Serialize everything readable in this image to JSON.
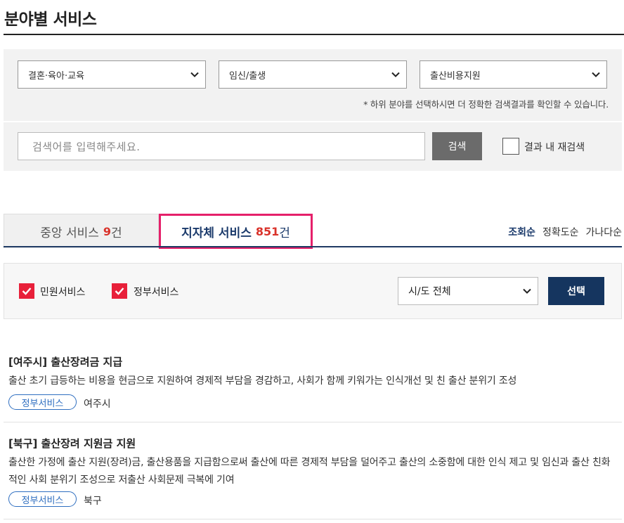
{
  "page": {
    "title": "분야별 서비스"
  },
  "filters": {
    "category1": "결혼·육아·교육",
    "category2": "임신/출생",
    "category3": "출산비용지원",
    "hint": "* 하위 분야를 선택하시면 더 정확한 검색결과를 확인할 수 있습니다."
  },
  "search": {
    "placeholder": "검색어를 입력해주세요.",
    "button_label": "검색",
    "re_search_label": "결과 내 재검색"
  },
  "tabs": [
    {
      "label": "중앙 서비스",
      "count": "9",
      "unit": "건",
      "active": false
    },
    {
      "label": "지자체 서비스",
      "count": "851",
      "unit": "건",
      "active": true
    }
  ],
  "sort": {
    "options": [
      "조회순",
      "정확도순",
      "가나다순"
    ],
    "active": "조회순"
  },
  "options": {
    "civil_label": "민원서비스",
    "gov_label": "정부서비스",
    "region_select": "시/도 전체",
    "apply_label": "선택"
  },
  "results": [
    {
      "title": "[여주시] 출산장려금 지급",
      "desc": "출산 초기 급등하는 비용을 현금으로 지원하여 경제적 부담을 경감하고, 사회가 함께 키워가는 인식개선 및 친 출산 분위기 조성",
      "badge": "정부서비스",
      "region": "여주시"
    },
    {
      "title": "[북구] 출산장려 지원금 지원",
      "desc": "출산한 가정에 출산 지원(장려)금, 출산용품을 지급함으로써 출산에 따른 경제적 부담을 덜어주고 출산의 소중함에 대한 인식 제고 및 임신과 출산 친화적인 사회 분위기 조성으로 저출산 사회문제 극복에 기여",
      "badge": "정부서비스",
      "region": "북구"
    }
  ],
  "colors": {
    "accent_red": "#e8203a",
    "navy": "#15355f",
    "tab_highlight": "#e5206a",
    "badge_blue": "#2e6ec0"
  }
}
